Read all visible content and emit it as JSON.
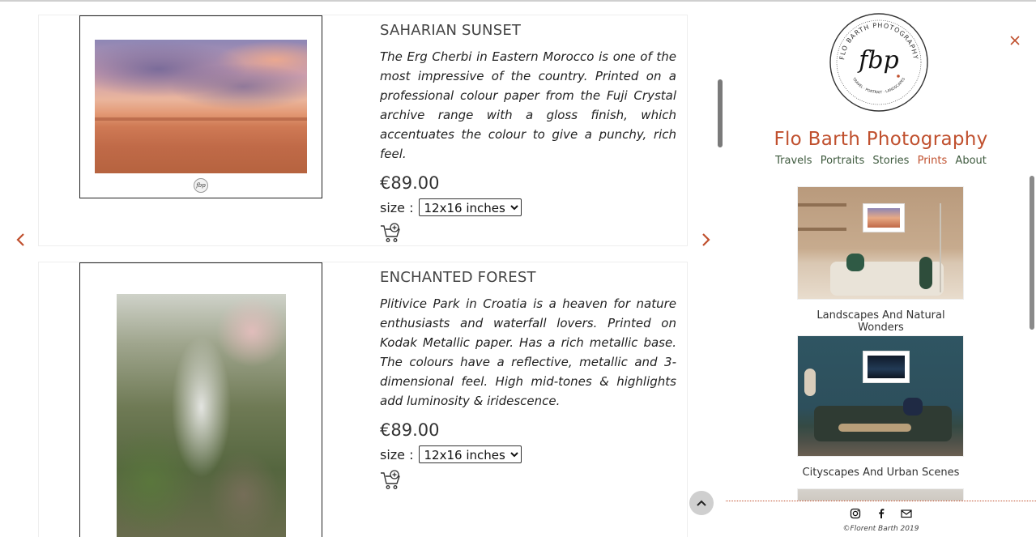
{
  "products": [
    {
      "title": "SAHARIAN SUNSET",
      "description": "The Erg Cherbi in Eastern Morocco is one of the most impressive of the country. Printed on a professional colour paper from the Fuji Crystal archive range with a gloss finish, which accentuates the colour to give a punchy, rich feel.",
      "price": "€89.00",
      "size_label": "size :",
      "size_selected": "12x16 inches"
    },
    {
      "title": "ENCHANTED FOREST",
      "description": "Plitivice Park in Croatia is a heaven for nature enthusiasts and waterfall lovers. Printed on Kodak Metallic paper. Has a rich metallic base. The colours have a reflective, metallic and 3-dimensional feel. High mid-tones & highlights add luminosity & iridescence.",
      "price": "€89.00",
      "size_label": "size :",
      "size_selected": "12x16 inches"
    }
  ],
  "sidebar": {
    "brand": "Flo Barth Photography",
    "logo_ring_text": "FLO BARTH PHOTOGRAPHY",
    "logo_sub_text": "TRAVEL · PORTRAIT · LANDSCAPES",
    "logo_mark": "fbp",
    "nav": [
      {
        "label": "Travels",
        "active": false
      },
      {
        "label": "Portraits",
        "active": false
      },
      {
        "label": "Stories",
        "active": false
      },
      {
        "label": "Prints",
        "active": true
      },
      {
        "label": "About",
        "active": false
      }
    ],
    "gallery": [
      {
        "caption": "Landscapes And Natural Wonders"
      },
      {
        "caption": "Cityscapes And Urban Scenes"
      }
    ],
    "copyright": "©Florent Barth 2019"
  },
  "colors": {
    "accent": "#c0502e",
    "nav_text": "#3e5a3e"
  },
  "icons": [
    "close-icon",
    "chevron-left-icon",
    "chevron-right-icon",
    "add-to-cart-icon",
    "chevron-up-icon",
    "instagram-icon",
    "facebook-icon",
    "mail-icon"
  ]
}
